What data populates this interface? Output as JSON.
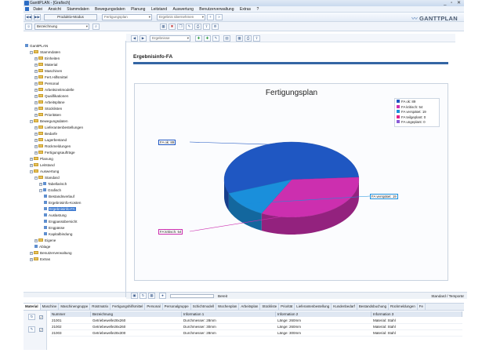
{
  "window": {
    "title": "GanttPLAN - [Grafisch]",
    "controls": "_ ▫ ✕"
  },
  "menu": [
    "Datei",
    "Ansicht",
    "Stammdaten",
    "Bewegungsdaten",
    "Planung",
    "Leitstand",
    "Auswertung",
    "Benutzerverwaltung",
    "Extras",
    "?"
  ],
  "toolbar": {
    "mode_button": "Produktiv-Modus",
    "plan_combo": "Fertigungsplan",
    "search_combo": "Ergebnis übernehmen",
    "brand": "GANTTPLAN",
    "row2_combo": "Bezeichnung"
  },
  "content_toolbar": {
    "view_combo": "Ergebnisse"
  },
  "tree": {
    "items": [
      {
        "label": "GanttPLAN",
        "level": 0,
        "expander": "",
        "icon": "app",
        "selected": false
      },
      {
        "label": "Stammdaten",
        "level": 1,
        "expander": "−",
        "icon": "folder",
        "selected": false
      },
      {
        "label": "Einheiten",
        "level": 2,
        "expander": "+",
        "icon": "folder",
        "selected": false
      },
      {
        "label": "Material",
        "level": 2,
        "expander": "+",
        "icon": "folder",
        "selected": false
      },
      {
        "label": "Maschinen",
        "level": 2,
        "expander": "+",
        "icon": "folder",
        "selected": false
      },
      {
        "label": "Fert.Hilfsmittel",
        "level": 2,
        "expander": "+",
        "icon": "folder",
        "selected": false
      },
      {
        "label": "Personal",
        "level": 2,
        "expander": "+",
        "icon": "folder",
        "selected": false
      },
      {
        "label": "Arbeitszeitmodelle",
        "level": 2,
        "expander": "+",
        "icon": "folder",
        "selected": false
      },
      {
        "label": "Qualifikationen",
        "level": 2,
        "expander": "+",
        "icon": "folder",
        "selected": false
      },
      {
        "label": "Arbeitspläne",
        "level": 2,
        "expander": "+",
        "icon": "folder",
        "selected": false
      },
      {
        "label": "Stücklisten",
        "level": 2,
        "expander": "+",
        "icon": "folder",
        "selected": false
      },
      {
        "label": "Prioritäten",
        "level": 2,
        "expander": "+",
        "icon": "folder",
        "selected": false
      },
      {
        "label": "Bewegungsdaten",
        "level": 1,
        "expander": "−",
        "icon": "folder",
        "selected": false
      },
      {
        "label": "Lieferantenbestellungen",
        "level": 2,
        "expander": "+",
        "icon": "folder",
        "selected": false
      },
      {
        "label": "Bedarfe",
        "level": 2,
        "expander": "+",
        "icon": "folder",
        "selected": false
      },
      {
        "label": "Lagerbestand",
        "level": 2,
        "expander": "+",
        "icon": "folder",
        "selected": false
      },
      {
        "label": "Rückmeldungen",
        "level": 2,
        "expander": "+",
        "icon": "folder",
        "selected": false
      },
      {
        "label": "Fertigungsaufträge",
        "level": 2,
        "expander": "+",
        "icon": "folder",
        "selected": false
      },
      {
        "label": "Planung",
        "level": 1,
        "expander": "+",
        "icon": "folder",
        "selected": false
      },
      {
        "label": "Leitstand",
        "level": 1,
        "expander": "+",
        "icon": "folder",
        "selected": false
      },
      {
        "label": "Auswertung",
        "level": 1,
        "expander": "−",
        "icon": "folder",
        "selected": false
      },
      {
        "label": "Standard",
        "level": 2,
        "expander": "−",
        "icon": "folder",
        "selected": false
      },
      {
        "label": "Tabellarisch",
        "level": 3,
        "expander": "+",
        "icon": "leaf",
        "selected": false
      },
      {
        "label": "Grafisch",
        "level": 3,
        "expander": "−",
        "icon": "leaf",
        "selected": false
      },
      {
        "label": "Bestandsverlauf",
        "level": 4,
        "expander": "",
        "icon": "leaf",
        "selected": false
      },
      {
        "label": "Ergebnisinfo-Kosten",
        "level": 4,
        "expander": "",
        "icon": "leaf",
        "selected": false
      },
      {
        "label": "Ergebnisinfo-FA",
        "level": 4,
        "expander": "",
        "icon": "leaf",
        "selected": true
      },
      {
        "label": "Auslastung",
        "level": 4,
        "expander": "",
        "icon": "leaf",
        "selected": false
      },
      {
        "label": "Engpassübersicht",
        "level": 4,
        "expander": "",
        "icon": "leaf",
        "selected": false
      },
      {
        "label": "Engpässe",
        "level": 4,
        "expander": "",
        "icon": "leaf",
        "selected": false
      },
      {
        "label": "Kapitalbindung",
        "level": 4,
        "expander": "",
        "icon": "leaf",
        "selected": false
      },
      {
        "label": "Eigene",
        "level": 2,
        "expander": "+",
        "icon": "folder",
        "selected": false
      },
      {
        "label": "Ablage",
        "level": 2,
        "expander": "",
        "icon": "leaf",
        "selected": false
      },
      {
        "label": "Benutzerverwaltung",
        "level": 1,
        "expander": "+",
        "icon": "folder",
        "selected": false
      },
      {
        "label": "Extras",
        "level": 1,
        "expander": "+",
        "icon": "folder",
        "selected": false
      }
    ]
  },
  "page": {
    "title": "Ergebnisinfo-FA"
  },
  "chart_data": {
    "type": "pie",
    "title": "Fertigungsplan",
    "legend_position": "top-right",
    "slices": [
      {
        "name": "FA ok",
        "value": 89,
        "color": "#1f57c2",
        "label": "FA ok: 89"
      },
      {
        "name": "FA kritisch",
        "value": 54,
        "color": "#cc2faf",
        "label": "FA kritisch: 54"
      },
      {
        "name": "FA verspätet",
        "value": 19,
        "color": "#1a8fdb",
        "label": "FA verspätet: 19"
      },
      {
        "name": "FA teilgeplant",
        "value": 0,
        "color": "#e0208a",
        "label": "FA teilgeplant: 0"
      },
      {
        "name": "FA ungeplant",
        "value": 0,
        "color": "#8a5bd6",
        "label": "FA ungeplant: 0"
      }
    ]
  },
  "status": {
    "message": "Bereit",
    "right": "Standard / Temporär"
  },
  "tabs": [
    {
      "label": "Material",
      "active": true
    },
    {
      "label": "Maschine",
      "active": false
    },
    {
      "label": "Maschinengruppe",
      "active": false
    },
    {
      "label": "Rüstmatrix",
      "active": false
    },
    {
      "label": "Fertigungshilfsmittel",
      "active": false
    },
    {
      "label": "Personal",
      "active": false
    },
    {
      "label": "Personalgruppe",
      "active": false
    },
    {
      "label": "Schichtmodell",
      "active": false
    },
    {
      "label": "Wochenplan",
      "active": false
    },
    {
      "label": "Arbeitsplan",
      "active": false
    },
    {
      "label": "Stückliste",
      "active": false
    },
    {
      "label": "Priorität",
      "active": false
    },
    {
      "label": "Lieferantenbestellung",
      "active": false
    },
    {
      "label": "Kundenbedarf",
      "active": false
    },
    {
      "label": "Bestandsbuchung",
      "active": false
    },
    {
      "label": "Rückmeldungen",
      "active": false
    },
    {
      "label": "Fe",
      "active": false
    }
  ],
  "grid": {
    "columns": [
      "Nummer",
      "Bezeichnung",
      "Information 1",
      "Information 2",
      "Information 3"
    ],
    "rows": [
      [
        "21001",
        "Getriebewelle28x260",
        "Durchmesser: 28mm",
        "Länge: 260mm",
        "Material: Stahl"
      ],
      [
        "21002",
        "Getriebewelle28x260",
        "Durchmesser: 30mm",
        "Länge: 260mm",
        "Material: Stahl"
      ],
      [
        "21003",
        "Getriebewelle28x300",
        "Durchmesser: 28mm",
        "Länge: 300mm",
        "Material: Stahl"
      ]
    ]
  }
}
